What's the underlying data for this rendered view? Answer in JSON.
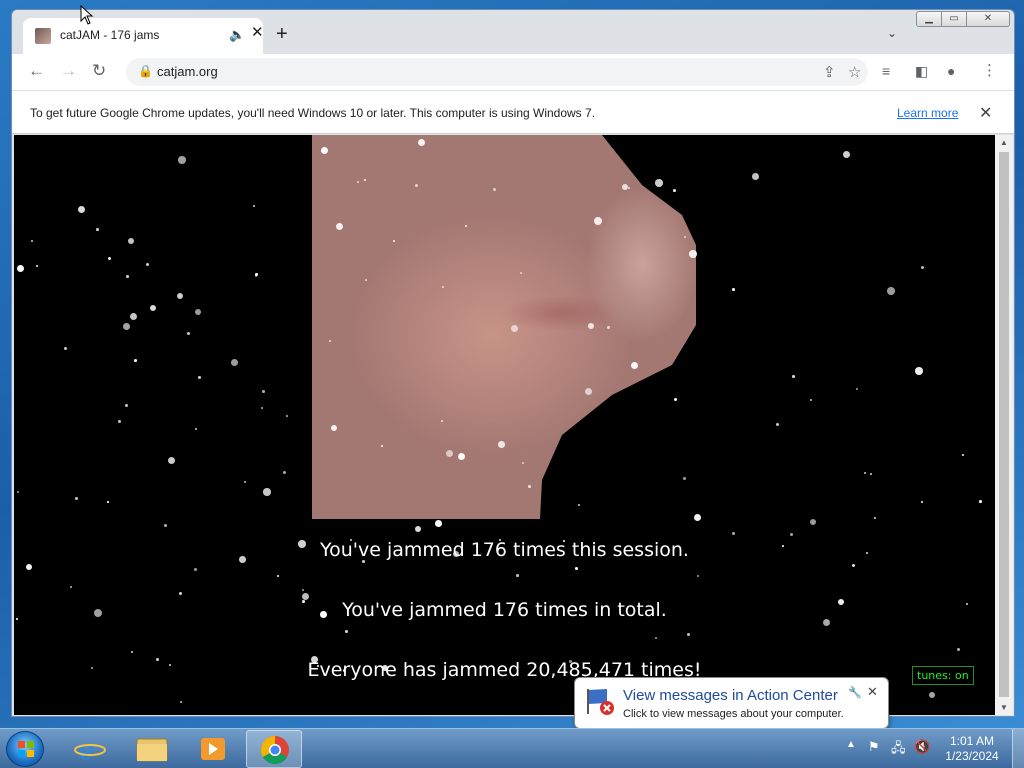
{
  "browser": {
    "tab": {
      "title": "catJAM - 176 jams",
      "audio_icon": "speaker-icon"
    },
    "address": "catjam.org",
    "infobar": {
      "message": "To get future Google Chrome updates, you'll need Windows 10 or later. This computer is using Windows 7.",
      "link": "Learn more"
    }
  },
  "page": {
    "session_text": "You've jammed 176 times this session.",
    "total_text": "You've jammed 176 times in total.",
    "everyone_text": "Everyone has jammed 20,485,471 times!",
    "tunes_label": "tunes: on"
  },
  "notification": {
    "title": "View messages in Action Center",
    "body": "Click to view messages about your computer."
  },
  "taskbar": {
    "apps": [
      "internet-explorer",
      "file-explorer",
      "media-player",
      "chrome"
    ],
    "active_app": "chrome",
    "time": "1:01 AM",
    "date": "1/23/2024"
  },
  "colors": {
    "tunes_green": "#22ee22",
    "link_blue": "#1a73e8",
    "notification_title": "#1e4aa0"
  }
}
